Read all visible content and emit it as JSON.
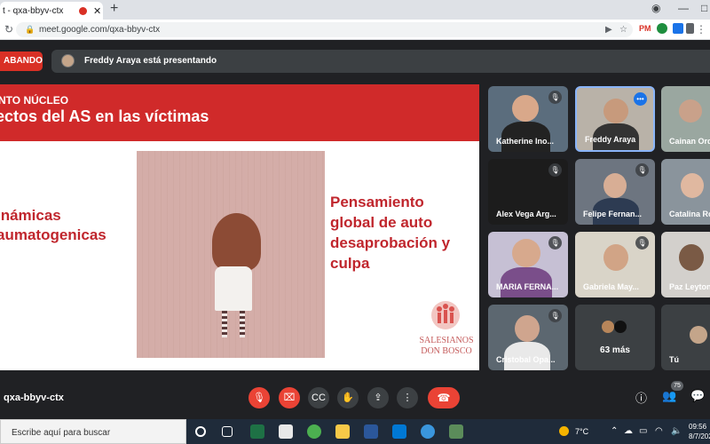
{
  "browser": {
    "tab_title": "t - qxa-bbyv-ctx",
    "tab_close": "✕",
    "new_tab": "+",
    "url": "meet.google.com/qxa-bbyv-ctx",
    "profile_label": "PM"
  },
  "meet": {
    "recording_label": "ABANDO",
    "presenting_text": "Freddy Araya está presentando",
    "meeting_code": "qxa-bbyv-ctx",
    "participants_badge": "75",
    "more_count": "63 más",
    "you_label": "Tú"
  },
  "slide": {
    "subtitle": "NTO NÚCLEO",
    "title": "ectos del AS en las víctimas",
    "left_text_line1": "inámicas",
    "left_text_line2": "aumatogenicas",
    "right_text_line1": "Pensamiento",
    "right_text_line2": "global de auto",
    "right_text_line3": "desaprobación y",
    "right_text_line4": "culpa",
    "logo_line1": "SALESIANOS",
    "logo_line2": "DON BOSCO"
  },
  "participants": [
    {
      "name": "Katherine Ino..."
    },
    {
      "name": "Freddy Araya"
    },
    {
      "name": "Cainan Ord"
    },
    {
      "name": "Alex Vega Arg..."
    },
    {
      "name": "Felipe Fernan..."
    },
    {
      "name": "Catalina Ro"
    },
    {
      "name": "MARIA FERNA..."
    },
    {
      "name": "Gabriela May..."
    },
    {
      "name": "Paz Leyton"
    },
    {
      "name": "Cristobal Opa..."
    }
  ],
  "taskbar": {
    "search_placeholder": "Escribe aquí para buscar",
    "temperature": "7°C",
    "time": "09:56",
    "date": "8/7/202"
  },
  "colors": {
    "accent_red": "#d02a2a",
    "meet_bg": "#202124",
    "control_bg": "#3c4043",
    "end_call": "#ea4335"
  }
}
